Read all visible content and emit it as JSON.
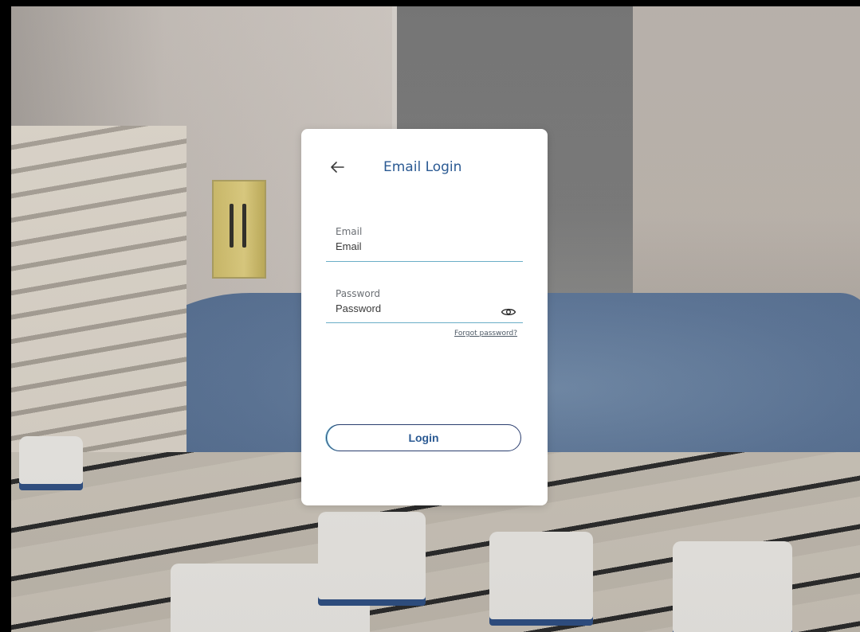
{
  "login": {
    "title": "Email Login",
    "email": {
      "label": "Email",
      "placeholder": "Email",
      "value": ""
    },
    "password": {
      "label": "Password",
      "placeholder": "Password",
      "value": ""
    },
    "forgot_label": "Forgot password?",
    "login_label": "Login"
  },
  "icons": {
    "back": "arrow-left-icon",
    "visibility": "eye-icon"
  },
  "colors": {
    "title": "#2b5a93",
    "field_underline": "#6aaec7",
    "button_border": "#2a3d6e"
  }
}
